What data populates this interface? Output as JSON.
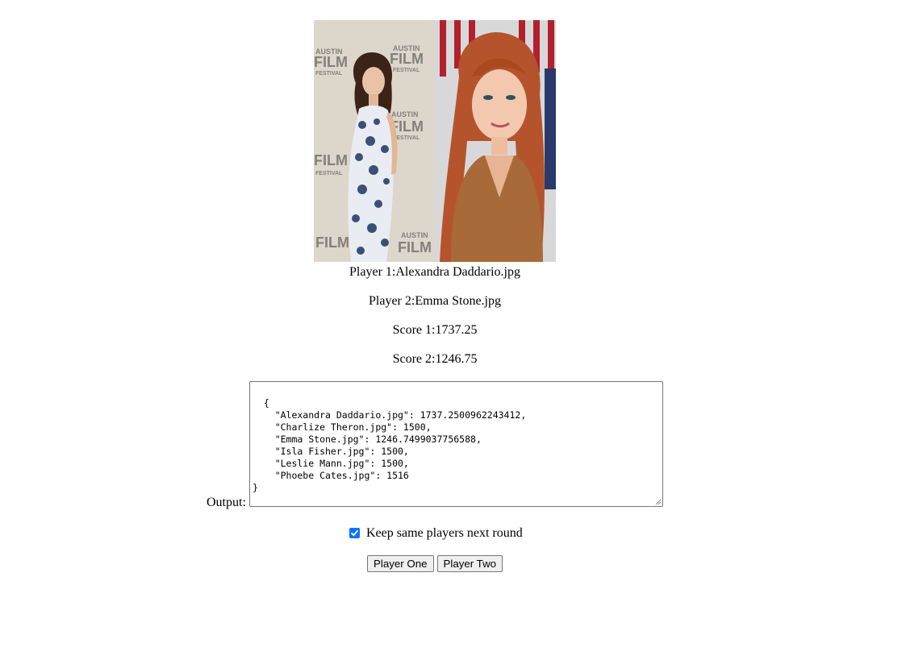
{
  "photos": {
    "left_alt": "Alexandra Daddario",
    "right_alt": "Emma Stone",
    "left_backdrop_text": "AUSTIN FILM FESTIVAL"
  },
  "info": {
    "player1_prefix": "Player 1:",
    "player1_value": "Alexandra Daddario.jpg",
    "player2_prefix": "Player 2:",
    "player2_value": "Emma Stone.jpg",
    "score1_prefix": "Score 1:",
    "score1_value": "1737.25",
    "score2_prefix": "Score 2:",
    "score2_value": "1246.75"
  },
  "output": {
    "label": "Output:",
    "text": "{\n    \"Alexandra Daddario.jpg\": 1737.2500962243412,\n    \"Charlize Theron.jpg\": 1500,\n    \"Emma Stone.jpg\": 1246.7499037756588,\n    \"Isla Fisher.jpg\": 1500,\n    \"Leslie Mann.jpg\": 1500,\n    \"Phoebe Cates.jpg\": 1516\n}"
  },
  "controls": {
    "keep_label": "Keep same players next round",
    "keep_checked": true,
    "checkbox_color": "#0a75ff",
    "player_one_button": "Player One",
    "player_two_button": "Player Two"
  }
}
